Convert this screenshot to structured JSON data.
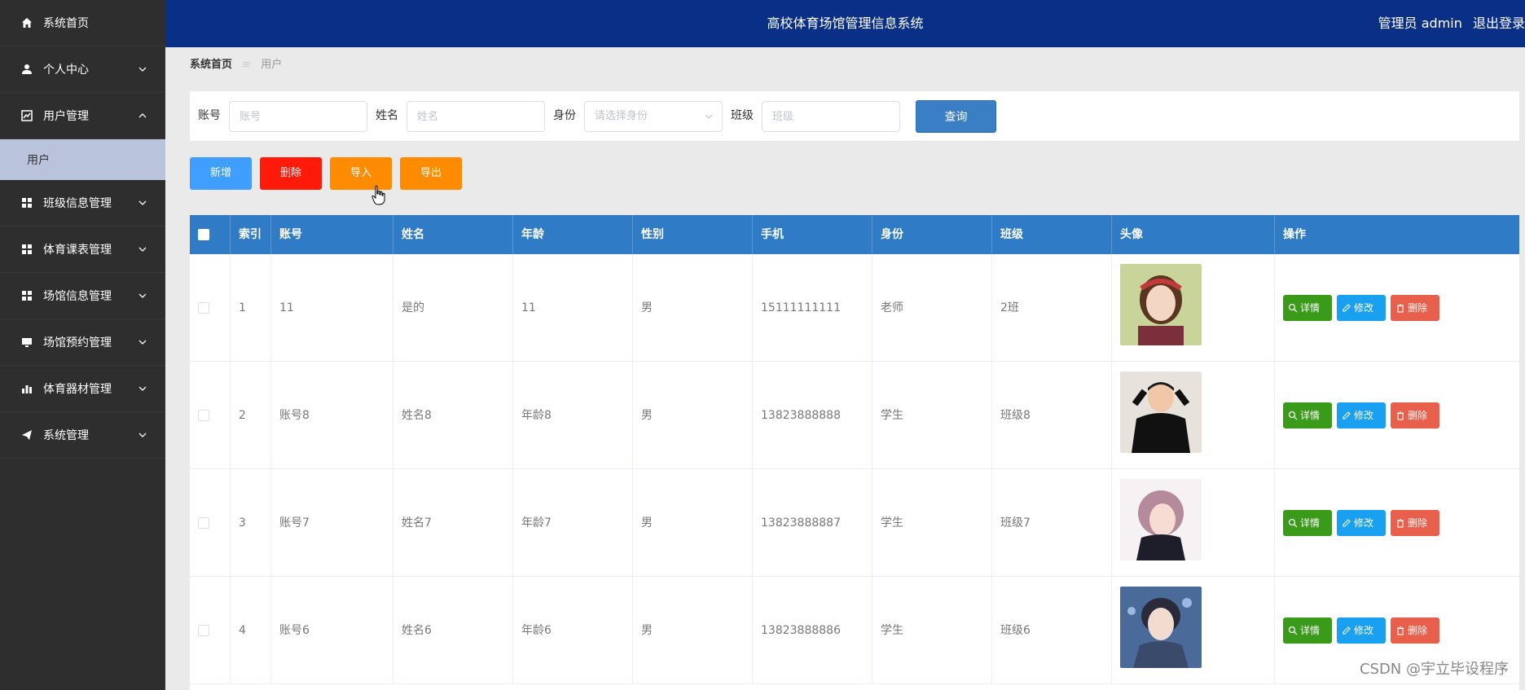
{
  "app": {
    "title": "高校体育场馆管理信息系统",
    "user_label": "管理员 admin",
    "logout_label": "退出登录"
  },
  "sidebar": {
    "items": [
      {
        "label": "系统首页",
        "icon": "home-icon"
      },
      {
        "label": "个人中心",
        "icon": "user-icon"
      },
      {
        "label": "用户管理",
        "icon": "chart-icon",
        "expanded": true,
        "sub": [
          "用户"
        ]
      },
      {
        "label": "班级信息管理",
        "icon": "grid-icon"
      },
      {
        "label": "体育课表管理",
        "icon": "grid-icon"
      },
      {
        "label": "场馆信息管理",
        "icon": "grid-icon"
      },
      {
        "label": "场馆预约管理",
        "icon": "monitor-icon"
      },
      {
        "label": "体育器材管理",
        "icon": "bar-chart-icon"
      },
      {
        "label": "系统管理",
        "icon": "send-icon"
      }
    ]
  },
  "breadcrumb": {
    "home": "系统首页",
    "sep": "≡",
    "current": "用户"
  },
  "search": {
    "account_label": "账号",
    "account_placeholder": "账号",
    "name_label": "姓名",
    "name_placeholder": "姓名",
    "role_label": "身份",
    "role_placeholder": "请选择身份",
    "class_label": "班级",
    "class_placeholder": "班级",
    "query_label": "查询"
  },
  "actions": {
    "add": "新增",
    "delete": "删除",
    "import": "导入",
    "export": "导出",
    "colors": {
      "add": "#409eff",
      "delete": "#ff1a0a",
      "import": "#ff8c00",
      "export": "#ff8c00"
    }
  },
  "table": {
    "headers": [
      "索引",
      "账号",
      "姓名",
      "年龄",
      "性别",
      "手机",
      "身份",
      "班级",
      "头像",
      "操作"
    ],
    "rows": [
      {
        "index": "1",
        "account": "11",
        "name": "是的",
        "age": "11",
        "gender": "男",
        "phone": "15111111111",
        "role": "老师",
        "class": "2班"
      },
      {
        "index": "2",
        "account": "账号8",
        "name": "姓名8",
        "age": "年龄8",
        "gender": "男",
        "phone": "13823888888",
        "role": "学生",
        "class": "班级8"
      },
      {
        "index": "3",
        "account": "账号7",
        "name": "姓名7",
        "age": "年龄7",
        "gender": "男",
        "phone": "13823888887",
        "role": "学生",
        "class": "班级7"
      },
      {
        "index": "4",
        "account": "账号6",
        "name": "姓名6",
        "age": "年龄6",
        "gender": "男",
        "phone": "13823888886",
        "role": "学生",
        "class": "班级6"
      }
    ],
    "ops": {
      "detail": "详情",
      "edit": "修改",
      "delete": "删除"
    },
    "op_colors": {
      "detail": "#3a9a1a",
      "edit": "#1aa0f0",
      "delete": "#e8604c"
    }
  },
  "watermark": "CSDN @宇立毕设程序"
}
